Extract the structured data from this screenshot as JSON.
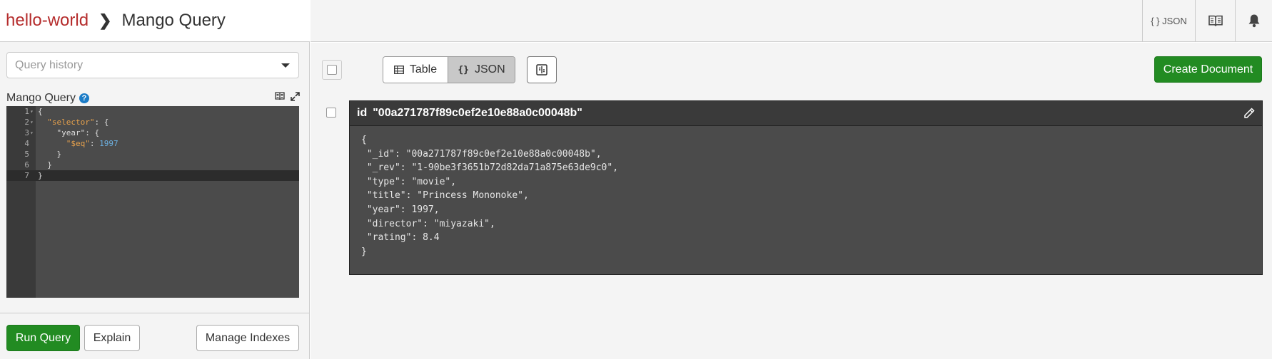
{
  "breadcrumb": {
    "database": "hello-world",
    "page": "Mango Query"
  },
  "query_history": {
    "placeholder": "Query history"
  },
  "mango": {
    "label": "Mango Query",
    "help_icon": "question-circle-icon",
    "lines": [
      {
        "n": "1",
        "fold": "▾",
        "text": "{"
      },
      {
        "n": "2",
        "fold": "▾",
        "text": "  \"selector\": {"
      },
      {
        "n": "3",
        "fold": "▾",
        "text": "    \"year\": {"
      },
      {
        "n": "4",
        "fold": "",
        "text": "      \"$eq\": 1997"
      },
      {
        "n": "5",
        "fold": "",
        "text": "    }"
      },
      {
        "n": "6",
        "fold": "",
        "text": "  }"
      },
      {
        "n": "7",
        "fold": "",
        "text": "}"
      }
    ]
  },
  "buttons": {
    "run": "Run Query",
    "explain": "Explain",
    "manage": "Manage Indexes",
    "create": "Create Document"
  },
  "header": {
    "json_label": "{ } JSON"
  },
  "view": {
    "table": "Table",
    "json": "JSON",
    "json_brace": "{}"
  },
  "document": {
    "id_label": "id",
    "id_value": "\"00a271787f89c0ef2e10e88a0c00048b\"",
    "lines": [
      "{",
      " \"_id\": \"00a271787f89c0ef2e10e88a0c00048b\",",
      " \"_rev\": \"1-90be3f3651b72d82da71a875e63de9c0\",",
      " \"type\": \"movie\",",
      " \"title\": \"Princess Mononoke\",",
      " \"year\": 1997,",
      " \"director\": \"miyazaki\",",
      " \"rating\": 8.4",
      "}"
    ]
  },
  "colors": {
    "accent_green": "#228b22",
    "db_red": "#b52d2d",
    "help_blue": "#1b7cc7"
  }
}
